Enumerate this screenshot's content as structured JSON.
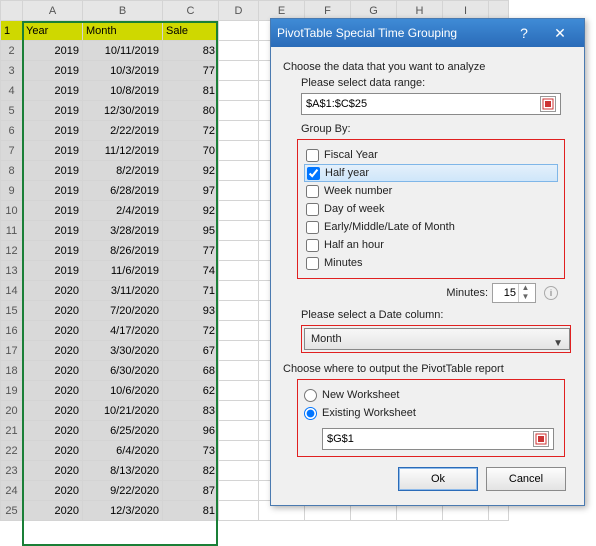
{
  "columns": [
    "A",
    "B",
    "C",
    "D",
    "E",
    "F",
    "G",
    "H",
    "I"
  ],
  "rows_count": 25,
  "header": {
    "c0": "Year",
    "c1": "Month",
    "c2": "Sale"
  },
  "data": [
    {
      "y": "2019",
      "m": "10/11/2019",
      "s": "83"
    },
    {
      "y": "2019",
      "m": "10/3/2019",
      "s": "77"
    },
    {
      "y": "2019",
      "m": "10/8/2019",
      "s": "81"
    },
    {
      "y": "2019",
      "m": "12/30/2019",
      "s": "80"
    },
    {
      "y": "2019",
      "m": "2/22/2019",
      "s": "72"
    },
    {
      "y": "2019",
      "m": "11/12/2019",
      "s": "70"
    },
    {
      "y": "2019",
      "m": "8/2/2019",
      "s": "92"
    },
    {
      "y": "2019",
      "m": "6/28/2019",
      "s": "97"
    },
    {
      "y": "2019",
      "m": "2/4/2019",
      "s": "92"
    },
    {
      "y": "2019",
      "m": "3/28/2019",
      "s": "95"
    },
    {
      "y": "2019",
      "m": "8/26/2019",
      "s": "77"
    },
    {
      "y": "2019",
      "m": "11/6/2019",
      "s": "74"
    },
    {
      "y": "2020",
      "m": "3/11/2020",
      "s": "71"
    },
    {
      "y": "2020",
      "m": "7/20/2020",
      "s": "93"
    },
    {
      "y": "2020",
      "m": "4/17/2020",
      "s": "72"
    },
    {
      "y": "2020",
      "m": "3/30/2020",
      "s": "67"
    },
    {
      "y": "2020",
      "m": "6/30/2020",
      "s": "68"
    },
    {
      "y": "2020",
      "m": "10/6/2020",
      "s": "62"
    },
    {
      "y": "2020",
      "m": "10/21/2020",
      "s": "83"
    },
    {
      "y": "2020",
      "m": "6/25/2020",
      "s": "96"
    },
    {
      "y": "2020",
      "m": "6/4/2020",
      "s": "73"
    },
    {
      "y": "2020",
      "m": "8/13/2020",
      "s": "82"
    },
    {
      "y": "2020",
      "m": "9/22/2020",
      "s": "87"
    },
    {
      "y": "2020",
      "m": "12/3/2020",
      "s": "81"
    }
  ],
  "dialog": {
    "title": "PivotTable Special Time Grouping",
    "help": "?",
    "close": "✕",
    "analyze_label": "Choose the data that you want to analyze",
    "range_label": "Please select data range:",
    "range_value": "$A$1:$C$25",
    "group_by_label": "Group By:",
    "group_items": {
      "fiscal": "Fiscal Year",
      "half": "Half year",
      "week": "Week number",
      "day": "Day of week",
      "eml": "Early/Middle/Late of Month",
      "halfhour": "Half an hour",
      "minutes": "Minutes"
    },
    "minutes_label": "Minutes:",
    "minutes_value": "15",
    "date_col_label": "Please select a Date column:",
    "date_col_value": "Month",
    "output_label": "Choose where to output the PivotTable report",
    "radio_new": "New Worksheet",
    "radio_existing": "Existing Worksheet",
    "out_cell": "$G$1",
    "ok": "Ok",
    "cancel": "Cancel"
  }
}
